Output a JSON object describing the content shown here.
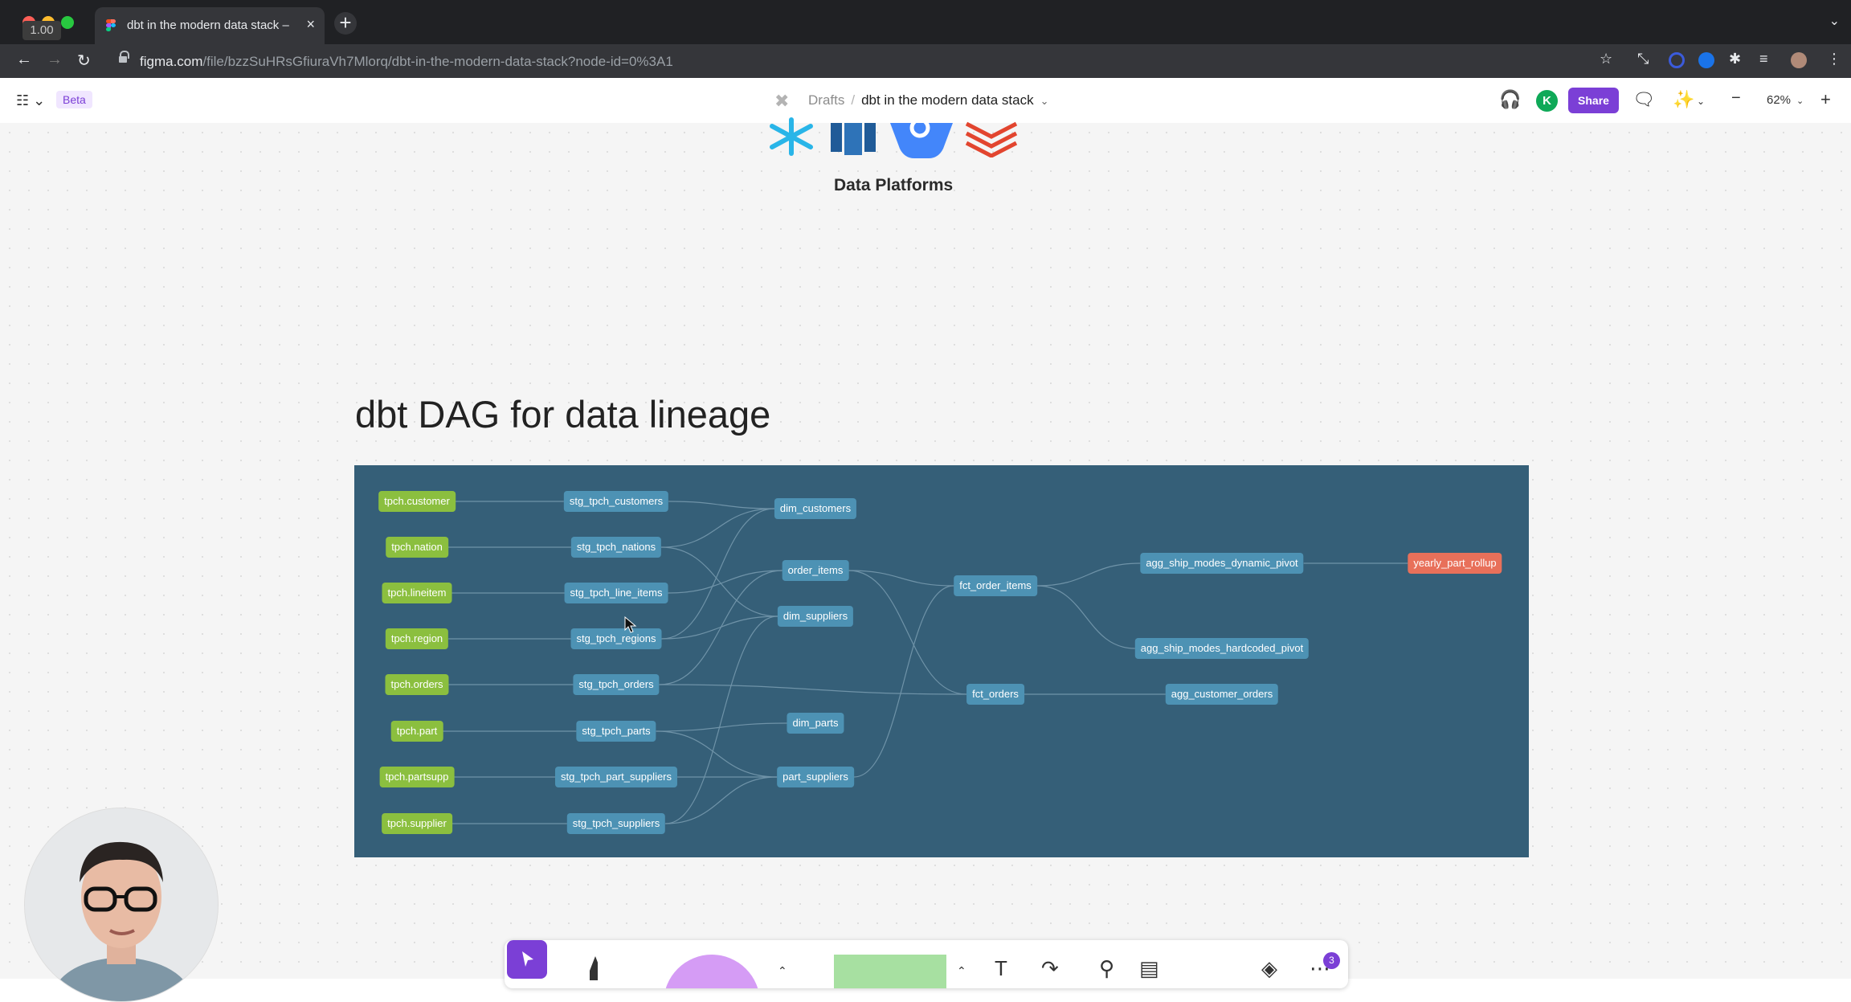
{
  "browser": {
    "zoom_badge": "1.00",
    "tab_title": "dbt in the modern data stack –",
    "tab_close": "×",
    "new_tab": "+",
    "tabs_menu": "⌄",
    "url_host": "figma.com",
    "url_path": "/file/bzzSuHRsGfiuraVh7Mlorq/dbt-in-the-modern-data-stack?node-id=0%3A1"
  },
  "figma_header": {
    "beta": "Beta",
    "breadcrumb_root": "Drafts",
    "breadcrumb_sep": "/",
    "file_name": "dbt in the modern data stack",
    "avatar_initial": "K",
    "share_label": "Share",
    "zoom_level": "62%",
    "zoom_out": "−",
    "zoom_in": "+"
  },
  "canvas": {
    "platforms_label": "Data Platforms",
    "section_title": "dbt DAG for data lineage"
  },
  "dag": {
    "nodes": {
      "tpch_customer": "tpch.customer",
      "tpch_nation": "tpch.nation",
      "tpch_lineitem": "tpch.lineitem",
      "tpch_region": "tpch.region",
      "tpch_orders": "tpch.orders",
      "tpch_part": "tpch.part",
      "tpch_partsupp": "tpch.partsupp",
      "tpch_supplier": "tpch.supplier",
      "stg_tpch_customers": "stg_tpch_customers",
      "stg_tpch_nations": "stg_tpch_nations",
      "stg_tpch_line_items": "stg_tpch_line_items",
      "stg_tpch_regions": "stg_tpch_regions",
      "stg_tpch_orders": "stg_tpch_orders",
      "stg_tpch_parts": "stg_tpch_parts",
      "stg_tpch_part_suppliers": "stg_tpch_part_suppliers",
      "stg_tpch_suppliers": "stg_tpch_suppliers",
      "dim_customers": "dim_customers",
      "order_items": "order_items",
      "dim_suppliers": "dim_suppliers",
      "dim_parts": "dim_parts",
      "part_suppliers": "part_suppliers",
      "fct_order_items": "fct_order_items",
      "fct_orders": "fct_orders",
      "agg_ship_modes_dynamic_pivot": "agg_ship_modes_dynamic_pivot",
      "agg_ship_modes_hardcoded_pivot": "agg_ship_modes_hardcoded_pivot",
      "agg_customer_orders": "agg_customer_orders",
      "yearly_part_rollup": "yearly_part_rollup"
    },
    "edges": [
      [
        "tpch_customer",
        "stg_tpch_customers"
      ],
      [
        "tpch_nation",
        "stg_tpch_nations"
      ],
      [
        "tpch_lineitem",
        "stg_tpch_line_items"
      ],
      [
        "tpch_region",
        "stg_tpch_regions"
      ],
      [
        "tpch_orders",
        "stg_tpch_orders"
      ],
      [
        "tpch_part",
        "stg_tpch_parts"
      ],
      [
        "tpch_partsupp",
        "stg_tpch_part_suppliers"
      ],
      [
        "tpch_supplier",
        "stg_tpch_suppliers"
      ],
      [
        "stg_tpch_customers",
        "dim_customers"
      ],
      [
        "stg_tpch_nations",
        "dim_customers"
      ],
      [
        "stg_tpch_regions",
        "dim_customers"
      ],
      [
        "stg_tpch_nations",
        "dim_suppliers"
      ],
      [
        "stg_tpch_regions",
        "dim_suppliers"
      ],
      [
        "stg_tpch_suppliers",
        "dim_suppliers"
      ],
      [
        "stg_tpch_line_items",
        "order_items"
      ],
      [
        "stg_tpch_orders",
        "order_items"
      ],
      [
        "stg_tpch_parts",
        "dim_parts"
      ],
      [
        "stg_tpch_parts",
        "part_suppliers"
      ],
      [
        "stg_tpch_part_suppliers",
        "part_suppliers"
      ],
      [
        "stg_tpch_suppliers",
        "part_suppliers"
      ],
      [
        "stg_tpch_orders",
        "fct_orders"
      ],
      [
        "order_items",
        "fct_order_items"
      ],
      [
        "order_items",
        "fct_orders"
      ],
      [
        "part_suppliers",
        "fct_order_items"
      ],
      [
        "fct_order_items",
        "agg_ship_modes_dynamic_pivot"
      ],
      [
        "fct_order_items",
        "agg_ship_modes_hardcoded_pivot"
      ],
      [
        "fct_orders",
        "agg_customer_orders"
      ],
      [
        "agg_ship_modes_dynamic_pivot",
        "yearly_part_rollup"
      ]
    ]
  },
  "bottom_toolbar": {
    "comments_count": "3"
  },
  "colors": {
    "figma_purple": "#7b3fd6",
    "dag_background": "#355f78",
    "source_node": "#8bbf3f",
    "model_node": "#4d92b4",
    "output_node": "#e8705a"
  }
}
